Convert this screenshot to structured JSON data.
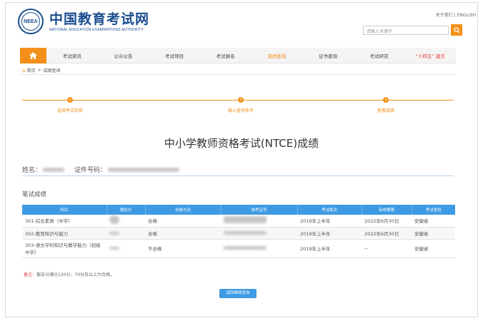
{
  "header": {
    "logo_emblem": "NEEA",
    "logo_cn": "中国教育考试网",
    "logo_en": "NATIONAL EDUCATION EXAMINATIONS AUTHORITY",
    "top_links": [
      "关于我们",
      "ENGLISH"
    ],
    "search_placeholder": "请输入关键字"
  },
  "nav": {
    "items": [
      {
        "label": "考试资讯",
        "state": "normal"
      },
      {
        "label": "公示公告",
        "state": "normal"
      },
      {
        "label": "考试项目",
        "state": "normal"
      },
      {
        "label": "考试报名",
        "state": "normal"
      },
      {
        "label": "成绩查询",
        "state": "active"
      },
      {
        "label": "证书查询",
        "state": "normal"
      },
      {
        "label": "考试研究",
        "state": "normal"
      },
      {
        "label": "“十四五” 建言",
        "state": "red"
      }
    ]
  },
  "breadcrumb": {
    "home": "首页",
    "separator": ">",
    "current": "成绩查询"
  },
  "steps": [
    {
      "num": "1",
      "label": "选择考试项目"
    },
    {
      "num": "2",
      "label": "输入查询条件"
    },
    {
      "num": "3",
      "label": "查看成绩"
    }
  ],
  "title": "中小学教师资格考试(NTCE)成绩",
  "info": {
    "name_label": "姓名：",
    "id_label": "证件号码："
  },
  "section_title": "笔试成绩",
  "table": {
    "headers": [
      "科目",
      "报告分",
      "合格与否",
      "准考证号",
      "考试批次",
      "有效期限",
      "考试省份"
    ],
    "rows": [
      {
        "subject": "301-综合素质（中学）",
        "pass": "合格",
        "batch": "2019年上半年",
        "valid": "2022年6月30日",
        "province": "安徽省"
      },
      {
        "subject": "302-教育知识与能力",
        "pass": "合格",
        "batch": "2019年上半年",
        "valid": "2022年6月30日",
        "province": "安徽省"
      },
      {
        "subject": "303-语文学科知识与教学能力（初级中学）",
        "pass": "不合格",
        "batch": "2019年上半年",
        "valid": "--",
        "province": "安徽省"
      }
    ]
  },
  "note": {
    "label": "备注：",
    "text": "报告分满分120分，70分及以上为合格。"
  },
  "back_button": "返回继续查询",
  "colors": {
    "brand": "#1a4d8f",
    "accent": "#f39019",
    "table_head": "#3e9be3",
    "alert": "#e83a3a"
  }
}
